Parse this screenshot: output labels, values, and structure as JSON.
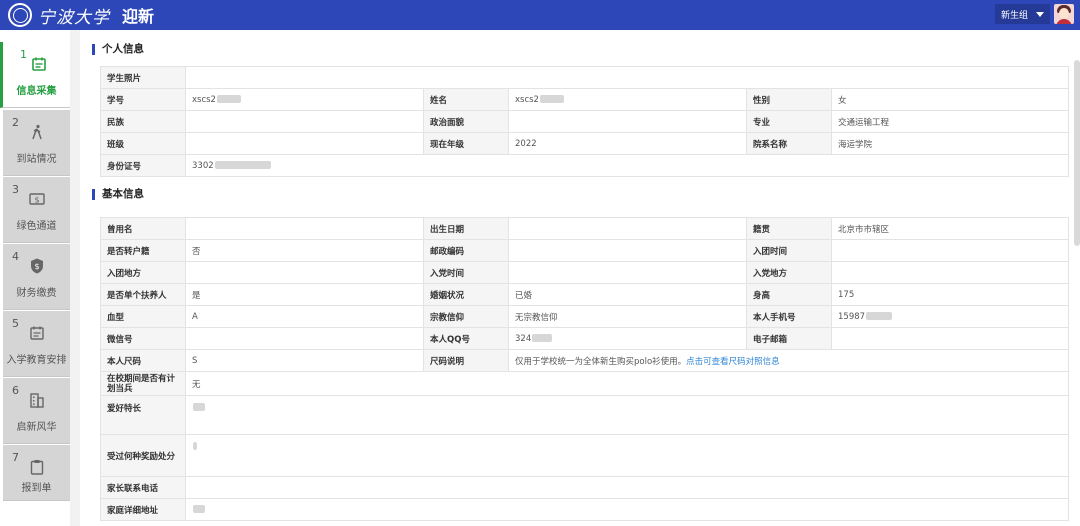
{
  "header": {
    "university": "宁波大学",
    "app_title": "迎新",
    "user_role": "新生组",
    "colors": {
      "header_bg": "#2e47b8",
      "active_green": "#27a043"
    }
  },
  "sidebar": {
    "steps": [
      {
        "num": "1",
        "label": "信息采集",
        "icon": "calendar-icon",
        "active": true
      },
      {
        "num": "2",
        "label": "到站情况",
        "icon": "walking-person-icon",
        "active": false
      },
      {
        "num": "3",
        "label": "绿色通道",
        "icon": "money-icon",
        "active": false
      },
      {
        "num": "4",
        "label": "财务缴费",
        "icon": "shield-dollar-icon",
        "active": false
      },
      {
        "num": "5",
        "label": "入学教育安排",
        "icon": "calendar-icon",
        "active": false
      },
      {
        "num": "6",
        "label": "启新风华",
        "icon": "building-icon",
        "active": false
      },
      {
        "num": "7",
        "label": "报到单",
        "icon": "clipboard-icon",
        "active": false
      }
    ]
  },
  "personal": {
    "title": "个人信息",
    "photo_label": "学生照片",
    "student_id_label": "学号",
    "student_id_value": "xscs2",
    "name_label": "姓名",
    "name_value": "xscs2",
    "gender_label": "性别",
    "gender_value": "女",
    "ethnicity_label": "民族",
    "political_label": "政治面貌",
    "major_label": "专业",
    "major_value": "交通运输工程",
    "class_label": "班级",
    "grade_label": "现在年级",
    "grade_value": "2022",
    "college_label": "院系名称",
    "college_value": "海运学院",
    "idcard_label": "身份证号",
    "idcard_value": "3302"
  },
  "basic": {
    "title": "基本信息",
    "former_name_label": "曾用名",
    "birth_label": "出生日期",
    "native_label": "籍贯",
    "native_value": "北京市市辖区",
    "hukou_label": "是否转户籍",
    "hukou_value": "否",
    "postcode_label": "邮政编码",
    "league_time_label": "入团时间",
    "league_place_label": "入团地方",
    "party_time_label": "入党时间",
    "party_place_label": "入党地方",
    "single_parent_label": "是否单个扶养人",
    "single_parent_value": "是",
    "marital_label": "婚姻状况",
    "marital_value": "已婚",
    "height_label": "身高",
    "height_value": "175",
    "blood_label": "血型",
    "blood_value": "A",
    "religion_label": "宗教信仰",
    "religion_value": "无宗教信仰",
    "phone_label": "本人手机号",
    "phone_value": "15987",
    "wechat_label": "微信号",
    "qq_label": "本人QQ号",
    "qq_value": "324",
    "email_label": "电子邮箱",
    "size_label": "本人尺码",
    "size_value": "S",
    "size_note_label": "尺码说明",
    "size_note_value": "仅用于学校统一为全体新生购买polo衫使用。",
    "size_note_link": "点击可查看尺码对照信息",
    "military_label": "在校期间是否有计划当兵",
    "military_value": "无",
    "hobby_label": "爱好特长",
    "award_label": "受过何种奖励处分",
    "parent_phone_label": "家长联系电话",
    "address_label": "家庭详细地址"
  }
}
